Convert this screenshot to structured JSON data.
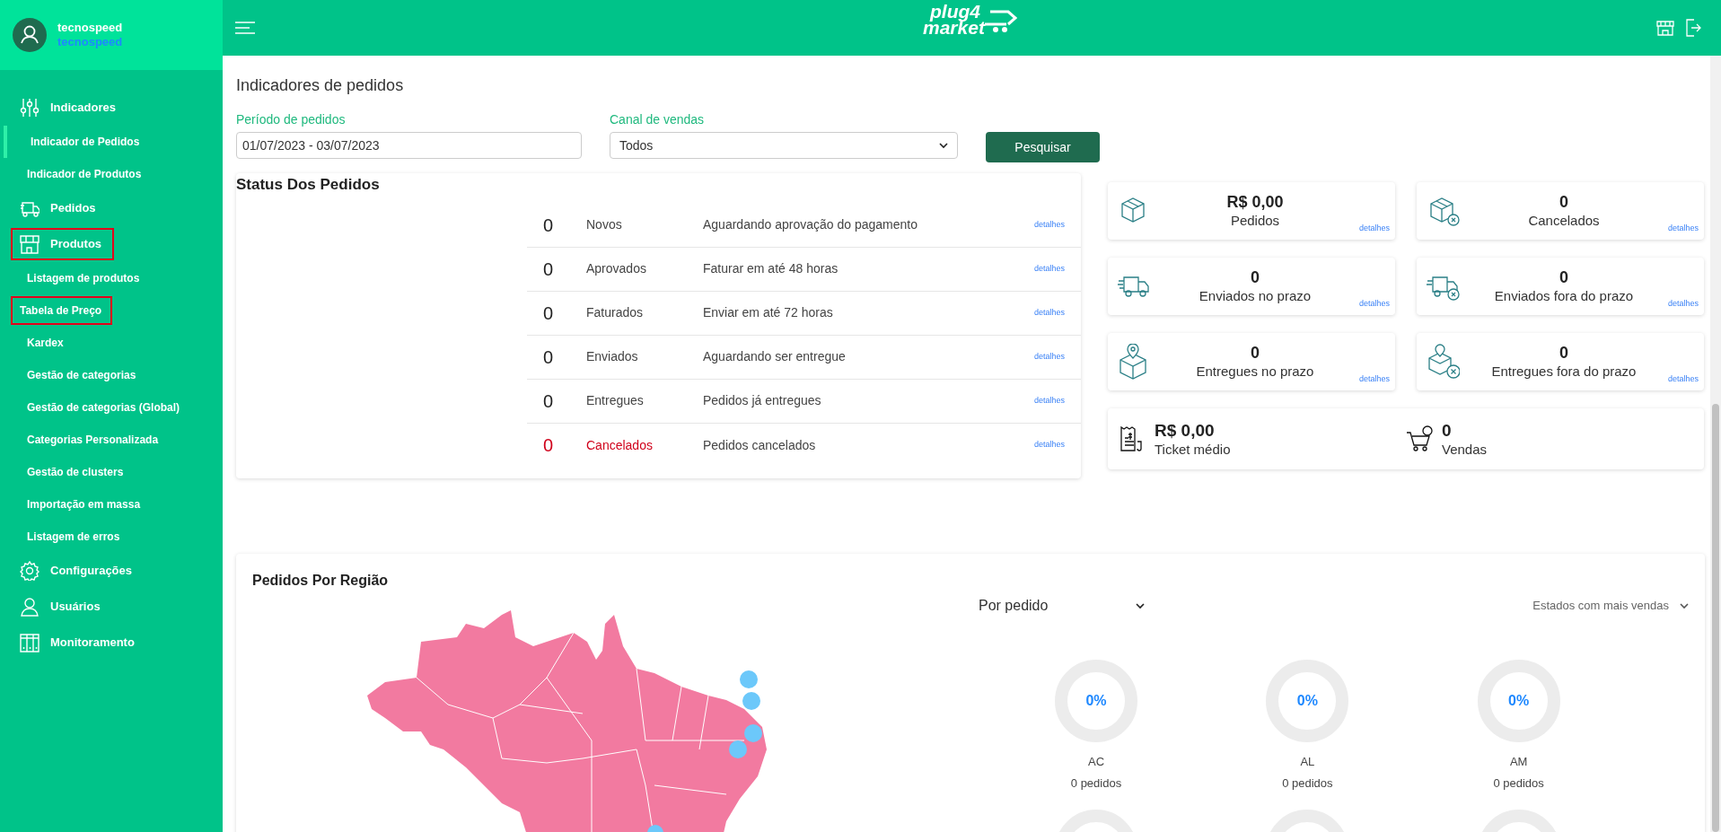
{
  "user": {
    "name": "tecnospeed",
    "company": "tecnospeed"
  },
  "sidebar": {
    "items": [
      {
        "kind": "section",
        "label": "Indicadores",
        "selected": false,
        "outlined": false
      },
      {
        "kind": "sub",
        "label": "Indicador de Pedidos",
        "selected": true,
        "outlined": false
      },
      {
        "kind": "sub",
        "label": "Indicador de Produtos",
        "selected": false,
        "outlined": false
      },
      {
        "kind": "section",
        "label": "Pedidos",
        "selected": false,
        "outlined": false
      },
      {
        "kind": "section",
        "label": "Produtos",
        "selected": false,
        "outlined": true
      },
      {
        "kind": "sub",
        "label": "Listagem de produtos",
        "selected": false,
        "outlined": false
      },
      {
        "kind": "sub",
        "label": "Tabela de Preço",
        "selected": false,
        "outlined": true
      },
      {
        "kind": "sub",
        "label": "Kardex",
        "selected": false,
        "outlined": false
      },
      {
        "kind": "sub",
        "label": "Gestão de categorias",
        "selected": false,
        "outlined": false
      },
      {
        "kind": "sub",
        "label": "Gestão de categorias (Global)",
        "selected": false,
        "outlined": false
      },
      {
        "kind": "sub",
        "label": "Categorias Personalizada",
        "selected": false,
        "outlined": false
      },
      {
        "kind": "sub",
        "label": "Gestão de clusters",
        "selected": false,
        "outlined": false
      },
      {
        "kind": "sub",
        "label": "Importação em massa",
        "selected": false,
        "outlined": false
      },
      {
        "kind": "sub",
        "label": "Listagem de erros",
        "selected": false,
        "outlined": false
      },
      {
        "kind": "section",
        "label": "Configurações",
        "selected": false,
        "outlined": false
      },
      {
        "kind": "section",
        "label": "Usuários",
        "selected": false,
        "outlined": false
      },
      {
        "kind": "section",
        "label": "Monitoramento",
        "selected": false,
        "outlined": false
      }
    ]
  },
  "header": {
    "logo_line_1": "plug4",
    "logo_line_2": "market"
  },
  "page_title": "Indicadores de pedidos",
  "filters": {
    "period": {
      "label": "Período de pedidos",
      "value": "01/07/2023 - 03/07/2023"
    },
    "channel": {
      "label": "Canal de vendas",
      "value": "Todos"
    },
    "button": "Pesquisar"
  },
  "status": {
    "title": "Status Dos Pedidos",
    "rows": [
      {
        "count": "0",
        "label": "Novos",
        "description": "Aguardando aprovação do pagamento",
        "link": "detalhes",
        "alert": false
      },
      {
        "count": "0",
        "label": "Aprovados",
        "description": "Faturar em até 48 horas",
        "link": "detalhes",
        "alert": false
      },
      {
        "count": "0",
        "label": "Faturados",
        "description": "Enviar em até 72 horas",
        "link": "detalhes",
        "alert": false
      },
      {
        "count": "0",
        "label": "Enviados",
        "description": "Aguardando ser entregue",
        "link": "detalhes",
        "alert": false
      },
      {
        "count": "0",
        "label": "Entregues",
        "description": "Pedidos já entregues",
        "link": "detalhes",
        "alert": false
      },
      {
        "count": "0",
        "label": "Cancelados",
        "description": "Pedidos cancelados",
        "link": "detalhes",
        "alert": true
      }
    ]
  },
  "cards": [
    {
      "value": "R$ 0,00",
      "label": "Pedidos",
      "link": "detalhes"
    },
    {
      "value": "0",
      "label": "Cancelados",
      "link": "detalhes"
    },
    {
      "value": "0",
      "label": "Enviados no prazo",
      "link": "detalhes"
    },
    {
      "value": "0",
      "label": "Enviados fora do prazo",
      "link": "detalhes"
    },
    {
      "value": "0",
      "label": "Entregues no prazo",
      "link": "detalhes"
    },
    {
      "value": "0",
      "label": "Entregues fora do prazo",
      "link": "detalhes"
    }
  ],
  "summary": [
    {
      "value": "R$ 0,00",
      "label": "Ticket médio"
    },
    {
      "value": "0",
      "label": "Vendas"
    }
  ],
  "region": {
    "title": "Pedidos Por Região",
    "metric": "Por pedido",
    "filter": "Estados com mais vendas",
    "states": [
      {
        "code": "AC",
        "percent": "0%",
        "orders": "0 pedidos"
      },
      {
        "code": "AL",
        "percent": "0%",
        "orders": "0 pedidos"
      },
      {
        "code": "AM",
        "percent": "0%",
        "orders": "0 pedidos"
      }
    ]
  }
}
